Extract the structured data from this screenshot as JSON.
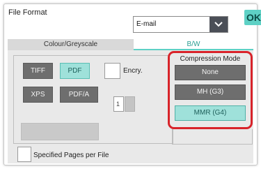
{
  "header": {
    "title": "File Format",
    "format_select_value": "E-mail",
    "ok_label": "OK"
  },
  "tabs": [
    {
      "label": "Colour/Greyscale",
      "active": false
    },
    {
      "label": "B/W",
      "active": true
    }
  ],
  "file_types": {
    "tiff": "TIFF",
    "pdf": "PDF",
    "xps": "XPS",
    "pdfa": "PDF/A",
    "selected": "PDF"
  },
  "encryption": {
    "label": "Encry.",
    "checked": false
  },
  "compression": {
    "title": "Compression Mode",
    "options": [
      "None",
      "MH (G3)",
      "MMR (G4)"
    ],
    "selected": "MMR (G4)"
  },
  "specified_pages": {
    "label": "Specified Pages per File",
    "checked": false,
    "value": "1"
  },
  "colors": {
    "accent": "#5ed1c5",
    "highlight_outline": "#d8232a",
    "button_dark": "#6e6e6e"
  }
}
